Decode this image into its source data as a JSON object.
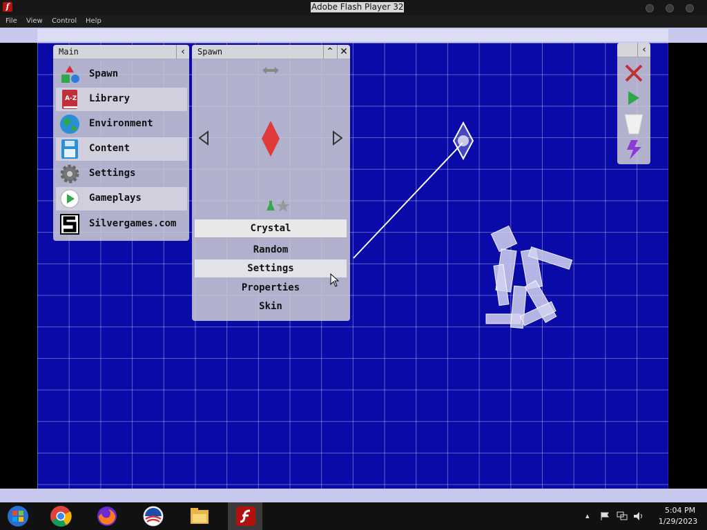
{
  "window": {
    "title": "Adobe Flash Player 32"
  },
  "menu": {
    "items": [
      "File",
      "View",
      "Control",
      "Help"
    ]
  },
  "main_panel": {
    "title": "Main",
    "items": [
      {
        "label": "Spawn",
        "icon": "spawn-shapes-icon"
      },
      {
        "label": "Library",
        "icon": "library-book-icon"
      },
      {
        "label": "Environment",
        "icon": "globe-icon"
      },
      {
        "label": "Content",
        "icon": "floppy-disk-icon"
      },
      {
        "label": "Settings",
        "icon": "gear-icon"
      },
      {
        "label": "Gameplays",
        "icon": "play-icon"
      },
      {
        "label": "Silvergames.com",
        "icon": "silvergames-logo-icon"
      }
    ]
  },
  "spawn_panel": {
    "title": "Spawn",
    "selected_item": "Crystal",
    "options": [
      "Random",
      "Settings",
      "Properties",
      "Skin"
    ]
  },
  "library_icon_text": "A-Z",
  "toolbar": {
    "tools": [
      "delete-icon",
      "play-icon",
      "bucket-icon",
      "lightning-icon"
    ]
  },
  "taskbar": {
    "time": "5:04 PM",
    "date": "1/29/2023",
    "apps": [
      "windows-start-icon",
      "chrome-icon",
      "firefox-icon",
      "obama-logo-icon",
      "file-explorer-icon",
      "flash-player-icon"
    ]
  },
  "colors": {
    "background": "#0a0aa8",
    "crystal": "#e03a3a",
    "panel": "#cdcdd4"
  }
}
